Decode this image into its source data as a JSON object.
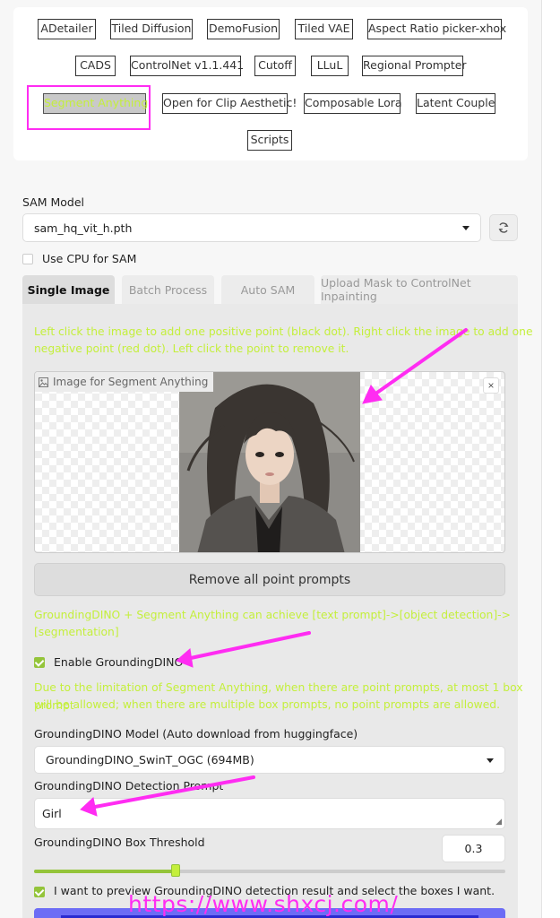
{
  "extension_tabs": [
    {
      "label": "ADetailer"
    },
    {
      "label": "Tiled Diffusion"
    },
    {
      "label": "DemoFusion"
    },
    {
      "label": "Tiled VAE"
    },
    {
      "label": "Aspect Ratio picker-xhox"
    },
    {
      "label": "CADS"
    },
    {
      "label": "ControlNet v1.1.441"
    },
    {
      "label": "Cutoff"
    },
    {
      "label": "LLuL"
    },
    {
      "label": "Regional Prompter"
    },
    {
      "label": "Segment Anything",
      "selected": true
    },
    {
      "label": "Open for Clip Aesthetic!"
    },
    {
      "label": "Composable Lora"
    },
    {
      "label": "Latent Couple"
    },
    {
      "label": "Scripts"
    }
  ],
  "sam": {
    "model_label": "SAM Model",
    "model_value": "sam_hq_vit_h.pth",
    "cpu_label": "Use CPU for SAM",
    "cpu_checked": false
  },
  "subtabs": [
    {
      "label": "Single Image",
      "active": true
    },
    {
      "label": "Batch Process"
    },
    {
      "label": "Auto SAM"
    },
    {
      "label": "Upload Mask to ControlNet Inpainting"
    }
  ],
  "single_image": {
    "instructions_line1": "Left click the image to add one positive point (black dot). Right click the image to add one",
    "instructions_line2": "negative point (red dot). Left click the point to remove it.",
    "image_label": "Image for Segment Anything",
    "close_symbol": "×",
    "remove_points_button": "Remove all point prompts",
    "dino_info_line1": "GroundingDINO + Segment Anything can achieve [text prompt]->[object detection]->",
    "dino_info_line2": "[segmentation]",
    "enable_dino_label": "Enable GroundingDINO",
    "enable_dino_checked": true,
    "dino_note_line1": "Due to the limitation of Segment Anything, when there are point prompts, at most 1 box prompt",
    "dino_note_line2": "will be allowed; when there are multiple box prompts, no point prompts are allowed.",
    "dino_model_label": "GroundingDINO Model (Auto download from huggingface)",
    "dino_model_value": "GroundingDINO_SwinT_OGC (694MB)",
    "dino_prompt_label": "GroundingDINO Detection Prompt",
    "dino_prompt_value": "Girl",
    "box_threshold_label": "GroundingDINO Box Threshold",
    "box_threshold_value": "0.3",
    "box_threshold_fraction": 0.3,
    "preview_label": "I want to preview GroundingDINO detection result and select the boxes I want.",
    "preview_checked": true
  },
  "watermark": "https://www.shxcj.com/",
  "colors": {
    "accent_green": "#c4ef3c",
    "annotation_magenta": "#ff2cf2",
    "check_green": "#94c43a"
  }
}
